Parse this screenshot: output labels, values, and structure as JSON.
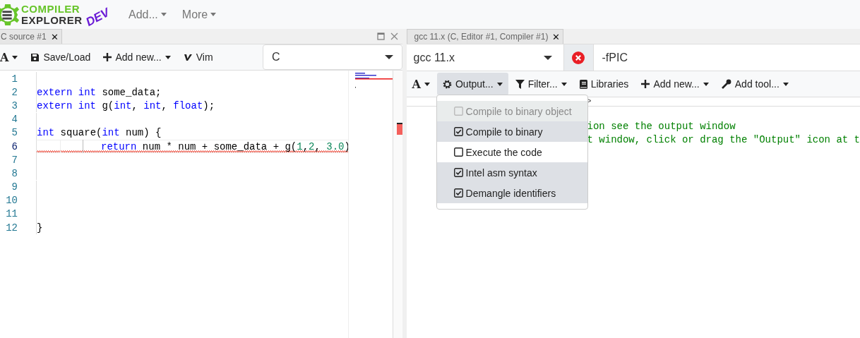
{
  "header": {
    "logo": {
      "line_1": "COMPILER",
      "line_2": "EXPLORER",
      "badge": "DEV"
    },
    "menus": [
      {
        "label": "Add..."
      },
      {
        "label": "More"
      }
    ]
  },
  "editor": {
    "tab": {
      "title": "C source #1",
      "close": "✕"
    },
    "toolbar": [
      {
        "kind": "font",
        "label": "A"
      },
      {
        "kind": "save",
        "label": "Save/Load"
      },
      {
        "kind": "add",
        "label": "Add new..."
      },
      {
        "kind": "vim",
        "label": "Vim"
      }
    ],
    "language": "C",
    "lines": [
      {
        "number": "1",
        "active": false,
        "squiggle": false,
        "guides": false
      },
      {
        "number": "2",
        "active": false,
        "squiggle": false,
        "guides": false,
        "tokens": [
          {
            "text": "extern int",
            "kind": "kw"
          },
          {
            "text": " some_data;",
            "kind": "id"
          }
        ]
      },
      {
        "number": "3",
        "active": false,
        "squiggle": false,
        "guides": false,
        "tokens": [
          {
            "text": "extern int",
            "kind": "kw"
          },
          {
            "text": " g(",
            "kind": "id"
          },
          {
            "text": "int",
            "kind": "kw"
          },
          {
            "text": ", ",
            "kind": "id"
          },
          {
            "text": "int",
            "kind": "kw"
          },
          {
            "text": ", ",
            "kind": "id"
          },
          {
            "text": "float",
            "kind": "kw"
          },
          {
            "text": ");",
            "kind": "id"
          }
        ]
      },
      {
        "number": "4",
        "active": false,
        "squiggle": false,
        "guides": false
      },
      {
        "number": "5",
        "active": false,
        "squiggle": false,
        "guides": false,
        "tokens": [
          {
            "text": "int",
            "kind": "kw"
          },
          {
            "text": " square(",
            "kind": "id"
          },
          {
            "text": "int",
            "kind": "kw"
          },
          {
            "text": " num) {",
            "kind": "id"
          }
        ]
      },
      {
        "number": "6",
        "active": true,
        "squiggle": true,
        "guides": true,
        "tokens": [
          {
            "text": "return",
            "kind": "kw"
          },
          {
            "text": " num * num + some_data + g(",
            "kind": "id"
          },
          {
            "text": "1",
            "kind": "num"
          },
          {
            "text": ",",
            "kind": "id"
          },
          {
            "text": "2",
            "kind": "num"
          },
          {
            "text": ", ",
            "kind": "id"
          },
          {
            "text": "3.0",
            "kind": "num"
          },
          {
            "text": ")",
            "kind": "id"
          }
        ]
      },
      {
        "number": "7",
        "active": false,
        "squiggle": false,
        "guides": false
      },
      {
        "number": "8",
        "active": false,
        "squiggle": false,
        "guides": false
      },
      {
        "number": "9",
        "active": false,
        "squiggle": false,
        "guides": false
      },
      {
        "number": "10",
        "active": false,
        "squiggle": false,
        "guides": false
      },
      {
        "number": "11",
        "active": false,
        "squiggle": false,
        "guides": false
      },
      {
        "number": "12",
        "active": false,
        "squiggle": false,
        "guides": false,
        "tokens": [
          {
            "text": "}",
            "kind": "id"
          }
        ]
      }
    ]
  },
  "compiler": {
    "tab": {
      "title": "gcc 11.x (C, Editor #1, Compiler #1)",
      "close": "✕"
    },
    "compiler_name": "gcc 11.x",
    "options": "-fPIC",
    "toolbar": [
      {
        "kind": "font",
        "label": "A",
        "selected": false
      },
      {
        "kind": "output",
        "label": "Output...",
        "selected": true
      },
      {
        "kind": "filter",
        "label": "Filter...",
        "selected": false
      },
      {
        "kind": "libraries",
        "label": "Libraries",
        "selected": false
      },
      {
        "kind": "add",
        "label": "Add new...",
        "selected": false
      },
      {
        "kind": "tool",
        "label": "Add tool...",
        "selected": false
      }
    ],
    "status_mark": ">",
    "output_lines": [
      "ion see the output window",
      "t window, click or drag the \"Output\" icon at t"
    ],
    "output_menu": [
      {
        "label": "Compile to binary object",
        "checked": false,
        "disabled": true
      },
      {
        "label": "Compile to binary",
        "checked": true,
        "disabled": false
      },
      {
        "label": "Execute the code",
        "checked": false,
        "disabled": false
      },
      {
        "label": "Intel asm syntax",
        "checked": true,
        "disabled": false
      },
      {
        "label": "Demangle identifiers",
        "checked": true,
        "disabled": false
      }
    ]
  }
}
